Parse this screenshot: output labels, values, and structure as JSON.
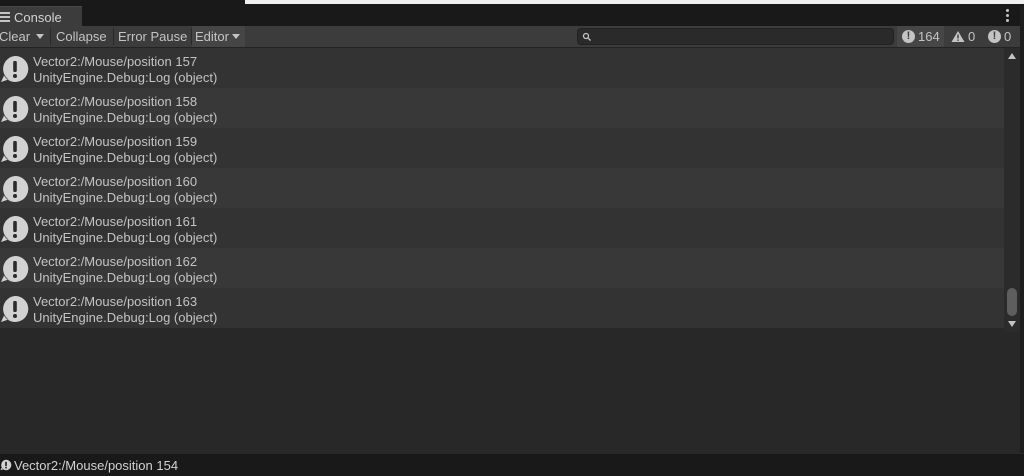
{
  "window": {
    "tab_title": "Console"
  },
  "toolbar": {
    "clear_label": "Clear",
    "collapse_label": "Collapse",
    "error_pause_label": "Error Pause",
    "editor_label": "Editor",
    "search_placeholder": "",
    "info_count": "164",
    "warning_count": "0",
    "error_count": "0"
  },
  "icons": {
    "tab": "list-icon",
    "menu": "kebab-icon",
    "search": "search-icon",
    "info": "info-icon",
    "warning": "warning-icon",
    "error": "error-icon",
    "log": "log-message-icon"
  },
  "logs": [
    {
      "message": "Vector2:/Mouse/position 157",
      "stack": "UnityEngine.Debug:Log (object)"
    },
    {
      "message": "Vector2:/Mouse/position 158",
      "stack": "UnityEngine.Debug:Log (object)"
    },
    {
      "message": "Vector2:/Mouse/position 159",
      "stack": "UnityEngine.Debug:Log (object)"
    },
    {
      "message": "Vector2:/Mouse/position 160",
      "stack": "UnityEngine.Debug:Log (object)"
    },
    {
      "message": "Vector2:/Mouse/position 161",
      "stack": "UnityEngine.Debug:Log (object)"
    },
    {
      "message": "Vector2:/Mouse/position 162",
      "stack": "UnityEngine.Debug:Log (object)"
    },
    {
      "message": "Vector2:/Mouse/position 163",
      "stack": "UnityEngine.Debug:Log (object)"
    }
  ],
  "status": {
    "message": "Vector2:/Mouse/position 154"
  },
  "colors": {
    "panel": "#282828",
    "toolbar": "#3c3c3c",
    "text": "#c4c4c4"
  }
}
